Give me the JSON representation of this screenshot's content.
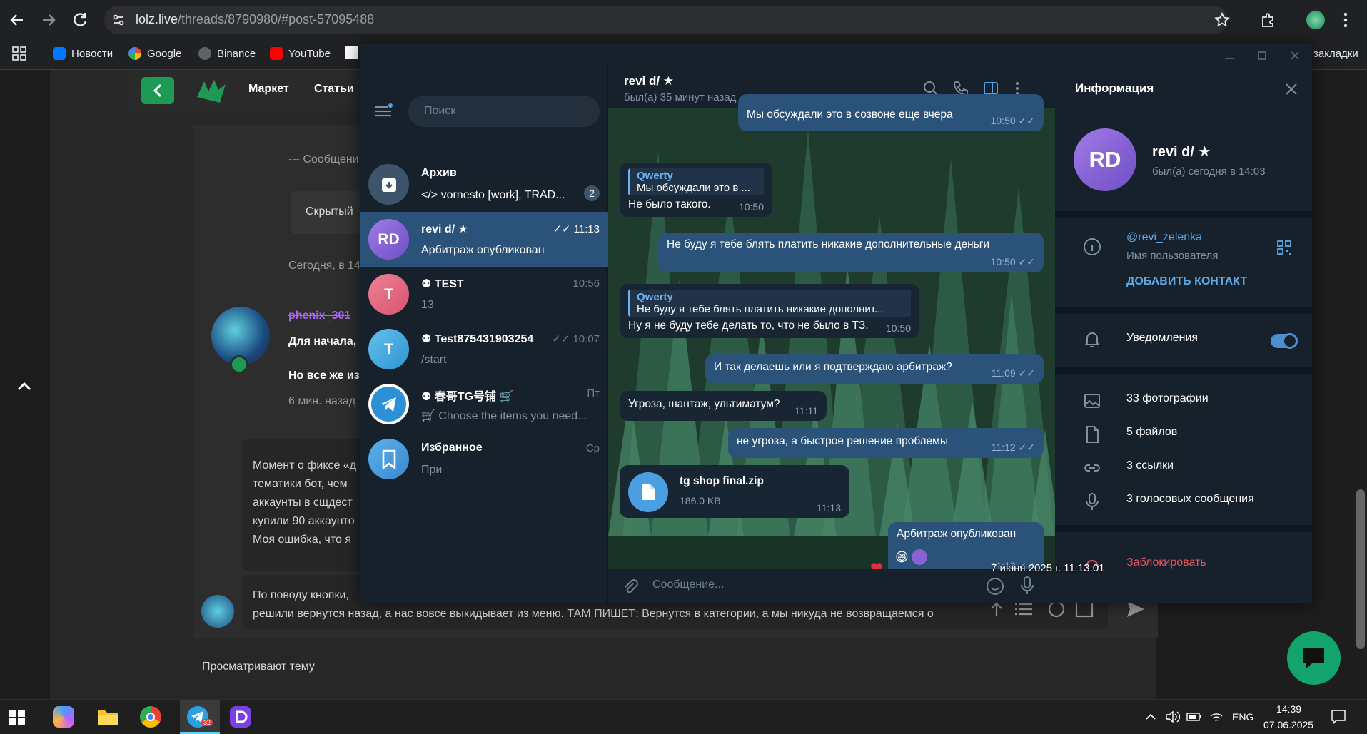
{
  "browser": {
    "url_host": "lolz.live",
    "url_path": "/threads/8790980/#post-57095488",
    "bookmarks": [
      "Новости",
      "Google",
      "Binance",
      "YouTube"
    ],
    "bookmarks_right": "закладки"
  },
  "forum": {
    "nav": [
      "Маркет",
      "Статьи"
    ],
    "line_messages": "--- Сообщени",
    "hidden": "Скрытый",
    "today": "Сегодня, в 14",
    "nick": "phenix_301",
    "start_text": "Для начала,",
    "but_all": "Но все же из",
    "ago": "6 мин. назад",
    "quote_lines": [
      "Момент о фиксе «д",
      "тематики бот, чем",
      "аккаунты в сщдест",
      "купили 90 аккаунто",
      "Моя ошибка, что я"
    ],
    "about_button": "По поводу кнопки,",
    "reply_text": "решили вернутся назад, а нас вовсе выкидывает из меню. ТАМ ПИШЕТ: Вернутся в категории, а мы никуда не возвращаемся о",
    "viewing": "Просматривают тему"
  },
  "telegram": {
    "search_placeholder": "Поиск",
    "chats": [
      {
        "name": "Архив",
        "preview": "</> vornesto [work], TRAD...",
        "time": "",
        "badge": "2",
        "avatar": "",
        "color": "#3e546a"
      },
      {
        "name": "revi d/ ★",
        "preview": "Арбитраж опубликован",
        "time": "✓✓ 11:13",
        "badge": "",
        "avatar": "RD",
        "color": "#8a63d2"
      },
      {
        "name": "TEST",
        "preview": "13",
        "time": "10:56",
        "badge": "",
        "avatar": "T",
        "color": "#e06a7c"
      },
      {
        "name": "Test875431903254",
        "preview": "/start",
        "time": "✓✓ 10:07",
        "badge": "",
        "avatar": "T",
        "color": "#3fa2d8"
      },
      {
        "name": "春哥TG号铺 🛒",
        "preview": "🛒 Choose the items you need...",
        "time": "Пт",
        "badge": "",
        "avatar": "",
        "color": "#2d8fd5"
      },
      {
        "name": "Избранное",
        "preview": "При",
        "time": "Ср",
        "badge": "",
        "avatar": "",
        "color": "#3a8fd6"
      }
    ],
    "peer_name": "revi d/ ★",
    "peer_status": "был(а) 35 минут назад",
    "messages": [
      {
        "text": "Мы обсуждали это в созвоне еще вчера",
        "time": "10:50 ✓✓"
      },
      {
        "quote_name": "Qwerty",
        "quote_text": "Мы обсуждали это в ...",
        "text": "Не было такого.",
        "time": "10:50"
      },
      {
        "text": "Не буду я тебе блять платить никакие дополнительные деньги",
        "time": "10:50 ✓✓"
      },
      {
        "quote_name": "Qwerty",
        "quote_text": "Не буду я тебе блять платить никакие дополнит...",
        "text": "Ну я не буду тебе делать то, что не было в ТЗ.",
        "time": "10:50"
      },
      {
        "text": "И так делаешь или я подтверждаю арбитраж?",
        "time": "11:09 ✓✓"
      },
      {
        "text": "Угроза, шантаж, ультиматум?",
        "time": "11:11"
      },
      {
        "text": "не угроза, а быстрое решение проблемы",
        "time": "11:12 ✓✓"
      },
      {
        "file_name": "tg shop final.zip",
        "file_size": "186.0 KB",
        "time": "11:13"
      },
      {
        "text": "Арбитраж опубликован",
        "reaction": "😄",
        "time": "11:13 ✓✓"
      }
    ],
    "composer_placeholder": "Сообщение...",
    "tooltip": "7 июня 2025 г. 11:13:01",
    "info": {
      "title": "Информация",
      "avatar": "RD",
      "name": "revi d/ ★",
      "status": "был(а) сегодня в 14:03",
      "username": "@revi_zelenka",
      "username_label": "Имя пользователя",
      "add_contact": "ДОБАВИТЬ КОНТАКТ",
      "notifications": "Уведомления",
      "photos": "33 фотографии",
      "files": "5 файлов",
      "links": "3 ссылки",
      "voice": "3 голосовых сообщения",
      "block": "Заблокировать"
    }
  },
  "taskbar": {
    "lang": "ENG",
    "time": "14:39",
    "date": "07.06.2025",
    "tg_badge": "32"
  }
}
